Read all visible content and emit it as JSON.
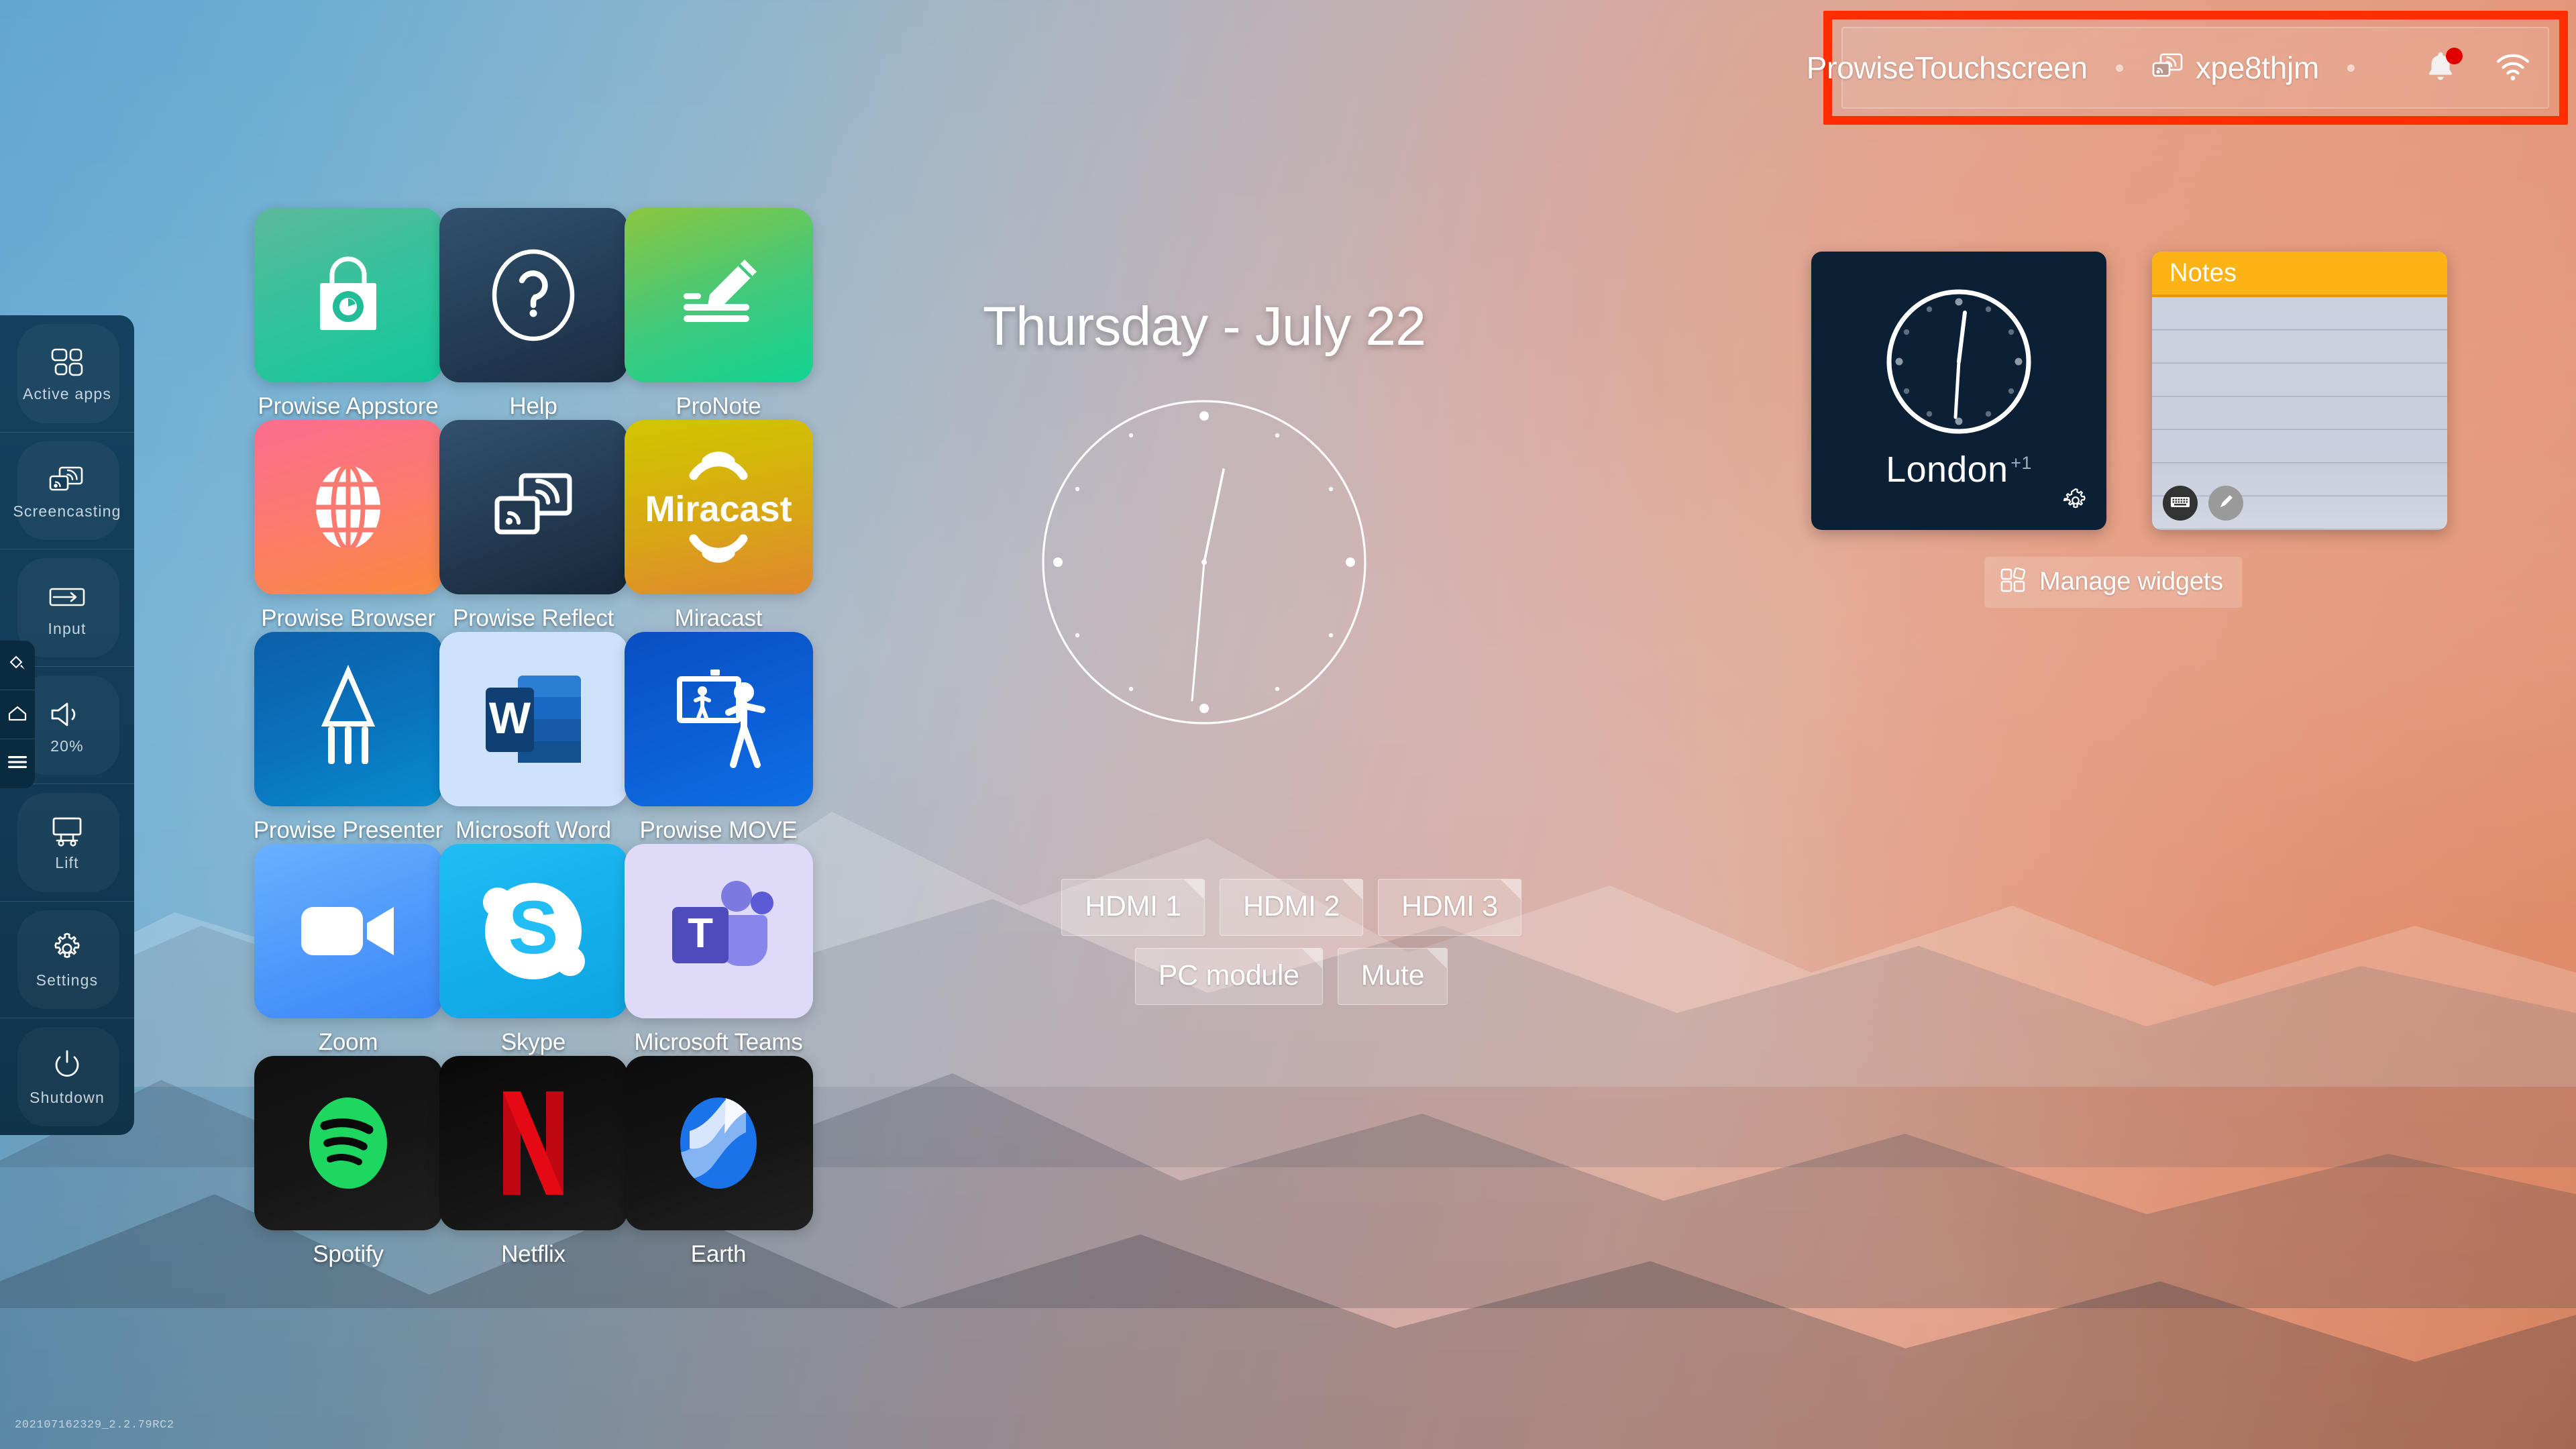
{
  "statusbar": {
    "device_name": "ProwiseTouchscreen",
    "cast_code": "xpe8thjm",
    "cast_icon": "screencast-icon",
    "bell_icon": "notification-bell-icon",
    "wifi_icon": "wifi-icon",
    "highlight_color": "#ff2d00",
    "badge_color": "#e00000"
  },
  "edge_tabs": [
    {
      "icon": "pen-icon",
      "name": "annotate"
    },
    {
      "icon": "home-icon",
      "name": "home"
    },
    {
      "icon": "hamburger-menu-icon",
      "name": "menu"
    }
  ],
  "sidebar": {
    "items": [
      {
        "label": "Active apps",
        "icon": "grid-squares-icon"
      },
      {
        "label": "Screencasting",
        "icon": "screencast-icon"
      },
      {
        "label": "Input",
        "icon": "input-arrow-icon"
      },
      {
        "label": "20%",
        "icon": "volume-icon"
      },
      {
        "label": "Lift",
        "icon": "lift-stand-icon"
      },
      {
        "label": "Settings",
        "icon": "gear-icon"
      },
      {
        "label": "Shutdown",
        "icon": "power-icon"
      }
    ]
  },
  "apps": [
    {
      "label": "Prowise Appstore",
      "icon": "shopping-bag-icon",
      "bg_from": "#57b79a",
      "bg_to": "#19c39a"
    },
    {
      "label": "Help",
      "icon": "question-mark-icon",
      "bg_from": "#2c4a66",
      "bg_to": "#1c3047"
    },
    {
      "label": "ProNote",
      "icon": "pencil-lines-icon",
      "bg_from": "#8bc34a",
      "bg_to": "#18d08a"
    },
    {
      "label": "Prowise Browser",
      "icon": "globe-icon",
      "bg_from": "#f96a8a",
      "bg_to": "#f98040"
    },
    {
      "label": "Prowise Reflect",
      "icon": "screencast-icon",
      "bg_from": "#2c4a66",
      "bg_to": "#18283c"
    },
    {
      "label": "Miracast",
      "icon": "miracast-wordmark",
      "bg_from": "#cdc100",
      "bg_to": "#e08a2e"
    },
    {
      "label": "Prowise Presenter",
      "icon": "pen-nib-icon",
      "bg_from": "#0e63ad",
      "bg_to": "#0b85cf"
    },
    {
      "label": "Microsoft Word",
      "icon": "word-w-icon",
      "bg_from": "#cfe2fb",
      "bg_to": "#cfe2fb"
    },
    {
      "label": "Prowise MOVE",
      "icon": "teacher-board-icon",
      "bg_from": "#0b4fc4",
      "bg_to": "#0e6ae2"
    },
    {
      "label": "Zoom",
      "icon": "video-camera-icon",
      "bg_from": "#5aa7ff",
      "bg_to": "#3d8cf7"
    },
    {
      "label": "Skype",
      "icon": "skype-s-icon",
      "bg_from": "#1ab7f2",
      "bg_to": "#12a5e8"
    },
    {
      "label": "Microsoft Teams",
      "icon": "teams-t-icon",
      "bg_from": "#dfdcf8",
      "bg_to": "#dcd8f7"
    },
    {
      "label": "Spotify",
      "icon": "spotify-icon",
      "bg_from": "#121212",
      "bg_to": "#1d1d1d"
    },
    {
      "label": "Netflix",
      "icon": "netflix-n-icon",
      "bg_from": "#0b0b0b",
      "bg_to": "#1b1b1b"
    },
    {
      "label": "Earth",
      "icon": "earth-globe-icon",
      "bg_from": "#0d0d0d",
      "bg_to": "#1e1e1e"
    }
  ],
  "center": {
    "date_text": "Thursday - July 22",
    "clock": {
      "hour_angle": 13,
      "minute_angle": 186,
      "hour_markers": 12
    }
  },
  "shortcuts": {
    "row1": [
      "HDMI 1",
      "HDMI 2",
      "HDMI 3"
    ],
    "row2": [
      "PC module",
      "Mute"
    ]
  },
  "widgets": {
    "clock": {
      "city": "London",
      "offset": "+1",
      "gear_icon": "gear-icon",
      "hour_angle": 8,
      "minute_angle": 183
    },
    "notes": {
      "title": "Notes",
      "header_color": "#fbb316",
      "lines": 6,
      "tools": [
        {
          "icon": "keyboard-icon",
          "name": "keyboard-input",
          "active": true
        },
        {
          "icon": "pen-icon",
          "name": "pen-input",
          "active": false
        }
      ]
    },
    "manage_button": {
      "label": "Manage widgets",
      "icon": "widgets-grid-icon"
    }
  },
  "version": "202107162329_2.2.79RC2"
}
